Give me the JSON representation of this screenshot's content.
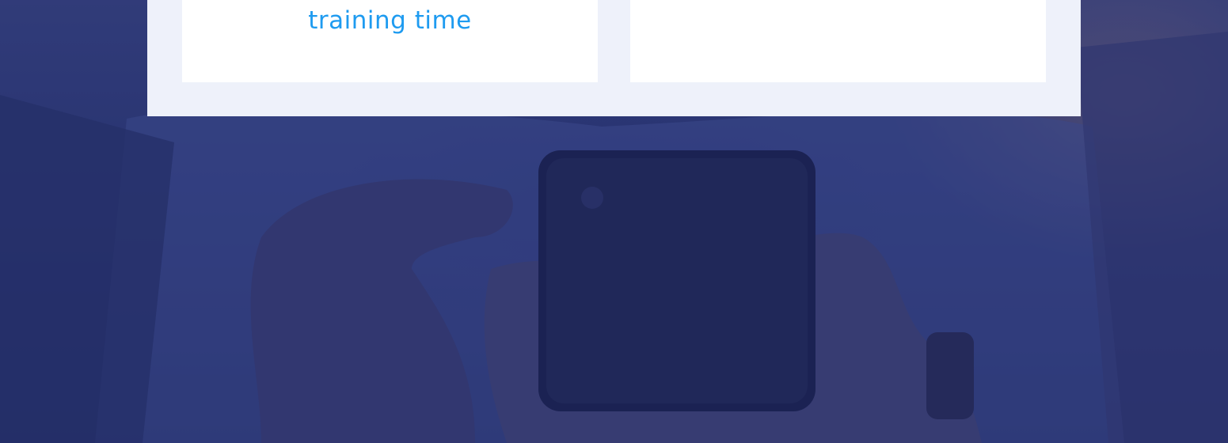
{
  "cards": [
    {
      "text": "training time"
    },
    {
      "text": ""
    }
  ],
  "colors": {
    "accent": "#1e9bf0",
    "panel": "#eef1fa",
    "card": "#ffffff",
    "overlay": "#2a3463"
  }
}
